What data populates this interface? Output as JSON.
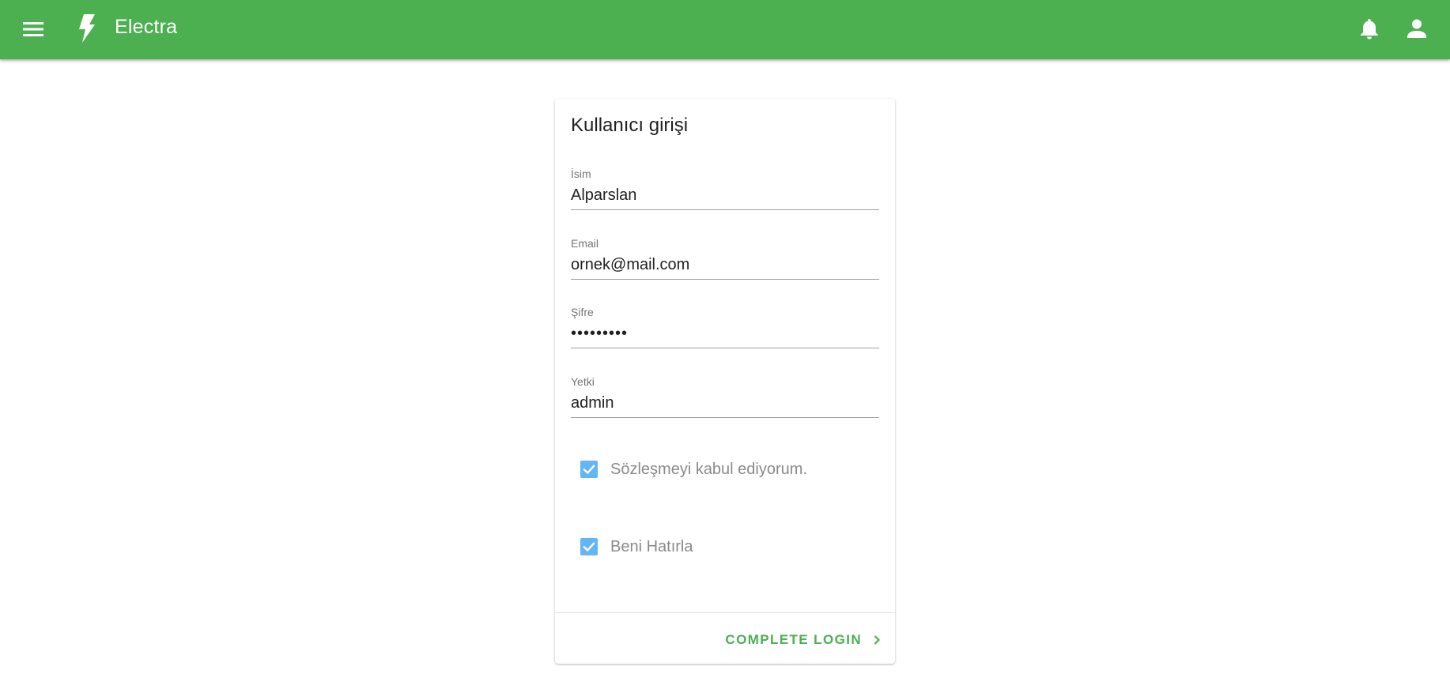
{
  "appbar": {
    "title": "Electra",
    "menu_icon": "menu-icon",
    "logo_icon": "lightning-bolt-icon",
    "bell_icon": "bell-icon",
    "user_icon": "account-icon",
    "color": "#4caf50"
  },
  "card": {
    "title": "Kullanıcı girişi",
    "fields": [
      {
        "label": "İsim",
        "value": "Alparslan"
      },
      {
        "label": "Email",
        "value": "ornek@mail.com"
      },
      {
        "label": "Şifre",
        "value": "•••••••••"
      },
      {
        "label": "Yetki",
        "value": "admin"
      }
    ],
    "checkboxes": [
      {
        "label": "Sözleşmeyi kabul ediyorum.",
        "checked": true
      },
      {
        "label": "Beni Hatırla",
        "checked": true
      }
    ],
    "submit_label": "COMPLETE LOGIN",
    "accent": "#4caf50",
    "checkbox_color": "#64b5f6"
  }
}
